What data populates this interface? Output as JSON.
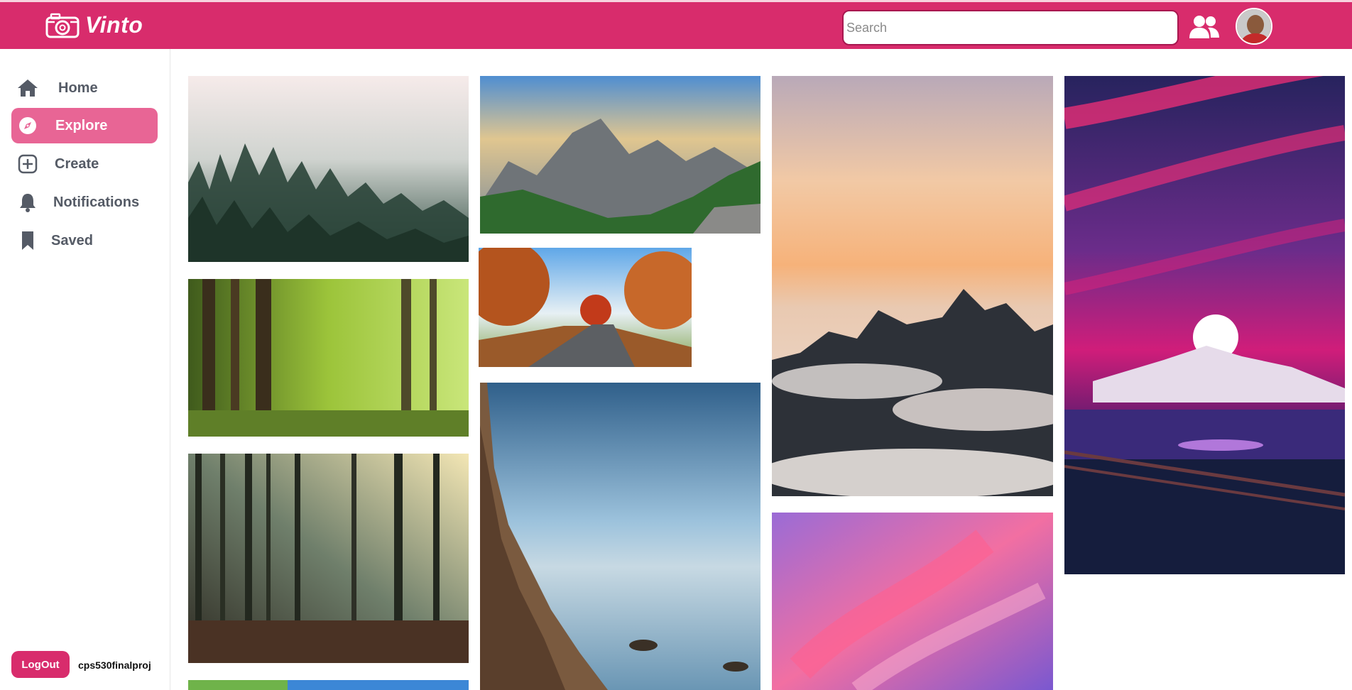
{
  "app": {
    "name": "Vinto"
  },
  "search": {
    "placeholder": "Search"
  },
  "sidebar": {
    "items": [
      {
        "label": "Home",
        "icon": "home-icon"
      },
      {
        "label": "Explore",
        "icon": "compass-icon",
        "active": true
      },
      {
        "label": "Create",
        "icon": "plus-square-icon"
      },
      {
        "label": "Notifications",
        "icon": "bell-icon"
      },
      {
        "label": "Saved",
        "icon": "bookmark-icon"
      }
    ]
  },
  "footer": {
    "logout_label": "LogOut",
    "username": "cps530finalproj"
  },
  "colors": {
    "brand": "#d82c6c",
    "active_nav": "#e86595",
    "nav_text": "#555b66"
  },
  "feed": {
    "photos": [
      {
        "subject": "misty pine forest"
      },
      {
        "subject": "mountain range with road"
      },
      {
        "subject": "sunset above clouds and peaks"
      },
      {
        "subject": "purple sky moonrise over snowy mountain"
      },
      {
        "subject": "green sunlit forest"
      },
      {
        "subject": "autumn road"
      },
      {
        "subject": "forest with sunbeams"
      },
      {
        "subject": "sea cliff with rocks"
      },
      {
        "subject": "pink and purple abstract sky"
      },
      {
        "subject": "green meadow under blue sky"
      }
    ]
  }
}
